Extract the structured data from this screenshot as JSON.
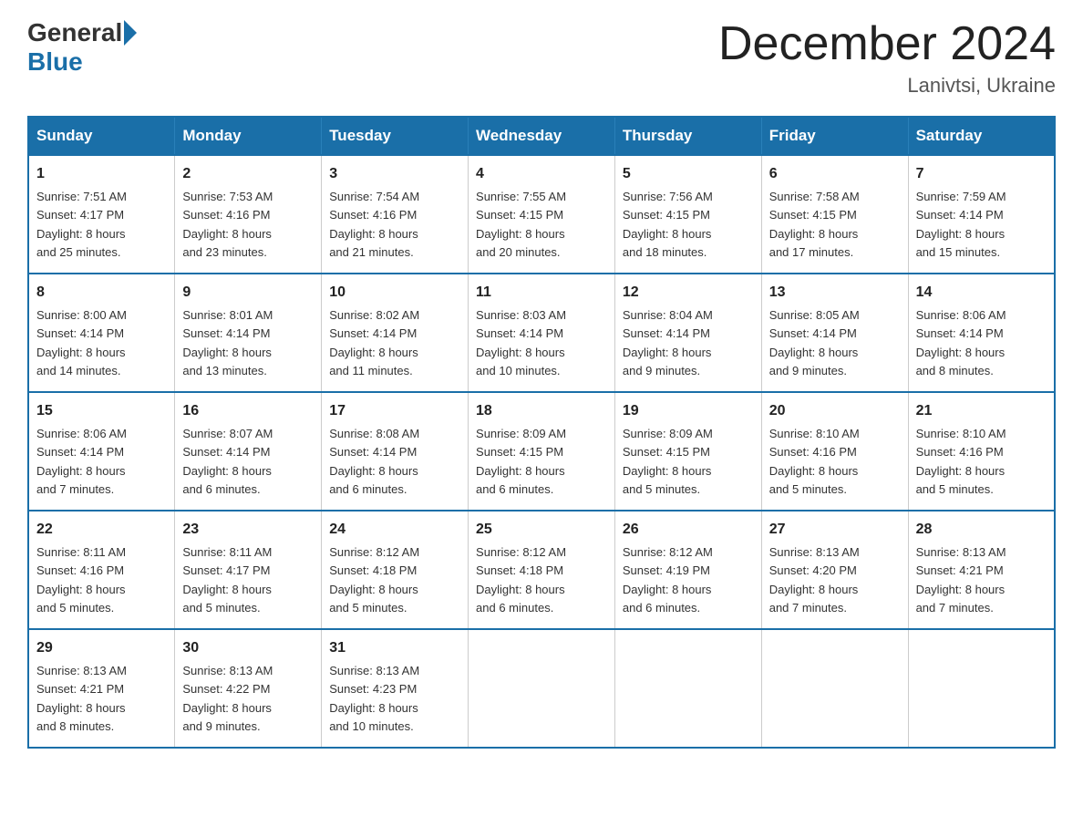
{
  "logo": {
    "general": "General",
    "blue": "Blue"
  },
  "title": "December 2024",
  "location": "Lanivtsi, Ukraine",
  "days_of_week": [
    "Sunday",
    "Monday",
    "Tuesday",
    "Wednesday",
    "Thursday",
    "Friday",
    "Saturday"
  ],
  "weeks": [
    [
      {
        "day": "1",
        "sunrise": "7:51 AM",
        "sunset": "4:17 PM",
        "daylight": "8 hours and 25 minutes."
      },
      {
        "day": "2",
        "sunrise": "7:53 AM",
        "sunset": "4:16 PM",
        "daylight": "8 hours and 23 minutes."
      },
      {
        "day": "3",
        "sunrise": "7:54 AM",
        "sunset": "4:16 PM",
        "daylight": "8 hours and 21 minutes."
      },
      {
        "day": "4",
        "sunrise": "7:55 AM",
        "sunset": "4:15 PM",
        "daylight": "8 hours and 20 minutes."
      },
      {
        "day": "5",
        "sunrise": "7:56 AM",
        "sunset": "4:15 PM",
        "daylight": "8 hours and 18 minutes."
      },
      {
        "day": "6",
        "sunrise": "7:58 AM",
        "sunset": "4:15 PM",
        "daylight": "8 hours and 17 minutes."
      },
      {
        "day": "7",
        "sunrise": "7:59 AM",
        "sunset": "4:14 PM",
        "daylight": "8 hours and 15 minutes."
      }
    ],
    [
      {
        "day": "8",
        "sunrise": "8:00 AM",
        "sunset": "4:14 PM",
        "daylight": "8 hours and 14 minutes."
      },
      {
        "day": "9",
        "sunrise": "8:01 AM",
        "sunset": "4:14 PM",
        "daylight": "8 hours and 13 minutes."
      },
      {
        "day": "10",
        "sunrise": "8:02 AM",
        "sunset": "4:14 PM",
        "daylight": "8 hours and 11 minutes."
      },
      {
        "day": "11",
        "sunrise": "8:03 AM",
        "sunset": "4:14 PM",
        "daylight": "8 hours and 10 minutes."
      },
      {
        "day": "12",
        "sunrise": "8:04 AM",
        "sunset": "4:14 PM",
        "daylight": "8 hours and 9 minutes."
      },
      {
        "day": "13",
        "sunrise": "8:05 AM",
        "sunset": "4:14 PM",
        "daylight": "8 hours and 9 minutes."
      },
      {
        "day": "14",
        "sunrise": "8:06 AM",
        "sunset": "4:14 PM",
        "daylight": "8 hours and 8 minutes."
      }
    ],
    [
      {
        "day": "15",
        "sunrise": "8:06 AM",
        "sunset": "4:14 PM",
        "daylight": "8 hours and 7 minutes."
      },
      {
        "day": "16",
        "sunrise": "8:07 AM",
        "sunset": "4:14 PM",
        "daylight": "8 hours and 6 minutes."
      },
      {
        "day": "17",
        "sunrise": "8:08 AM",
        "sunset": "4:14 PM",
        "daylight": "8 hours and 6 minutes."
      },
      {
        "day": "18",
        "sunrise": "8:09 AM",
        "sunset": "4:15 PM",
        "daylight": "8 hours and 6 minutes."
      },
      {
        "day": "19",
        "sunrise": "8:09 AM",
        "sunset": "4:15 PM",
        "daylight": "8 hours and 5 minutes."
      },
      {
        "day": "20",
        "sunrise": "8:10 AM",
        "sunset": "4:16 PM",
        "daylight": "8 hours and 5 minutes."
      },
      {
        "day": "21",
        "sunrise": "8:10 AM",
        "sunset": "4:16 PM",
        "daylight": "8 hours and 5 minutes."
      }
    ],
    [
      {
        "day": "22",
        "sunrise": "8:11 AM",
        "sunset": "4:16 PM",
        "daylight": "8 hours and 5 minutes."
      },
      {
        "day": "23",
        "sunrise": "8:11 AM",
        "sunset": "4:17 PM",
        "daylight": "8 hours and 5 minutes."
      },
      {
        "day": "24",
        "sunrise": "8:12 AM",
        "sunset": "4:18 PM",
        "daylight": "8 hours and 5 minutes."
      },
      {
        "day": "25",
        "sunrise": "8:12 AM",
        "sunset": "4:18 PM",
        "daylight": "8 hours and 6 minutes."
      },
      {
        "day": "26",
        "sunrise": "8:12 AM",
        "sunset": "4:19 PM",
        "daylight": "8 hours and 6 minutes."
      },
      {
        "day": "27",
        "sunrise": "8:13 AM",
        "sunset": "4:20 PM",
        "daylight": "8 hours and 7 minutes."
      },
      {
        "day": "28",
        "sunrise": "8:13 AM",
        "sunset": "4:21 PM",
        "daylight": "8 hours and 7 minutes."
      }
    ],
    [
      {
        "day": "29",
        "sunrise": "8:13 AM",
        "sunset": "4:21 PM",
        "daylight": "8 hours and 8 minutes."
      },
      {
        "day": "30",
        "sunrise": "8:13 AM",
        "sunset": "4:22 PM",
        "daylight": "8 hours and 9 minutes."
      },
      {
        "day": "31",
        "sunrise": "8:13 AM",
        "sunset": "4:23 PM",
        "daylight": "8 hours and 10 minutes."
      },
      null,
      null,
      null,
      null
    ]
  ],
  "labels": {
    "sunrise": "Sunrise:",
    "sunset": "Sunset:",
    "daylight": "Daylight:"
  }
}
